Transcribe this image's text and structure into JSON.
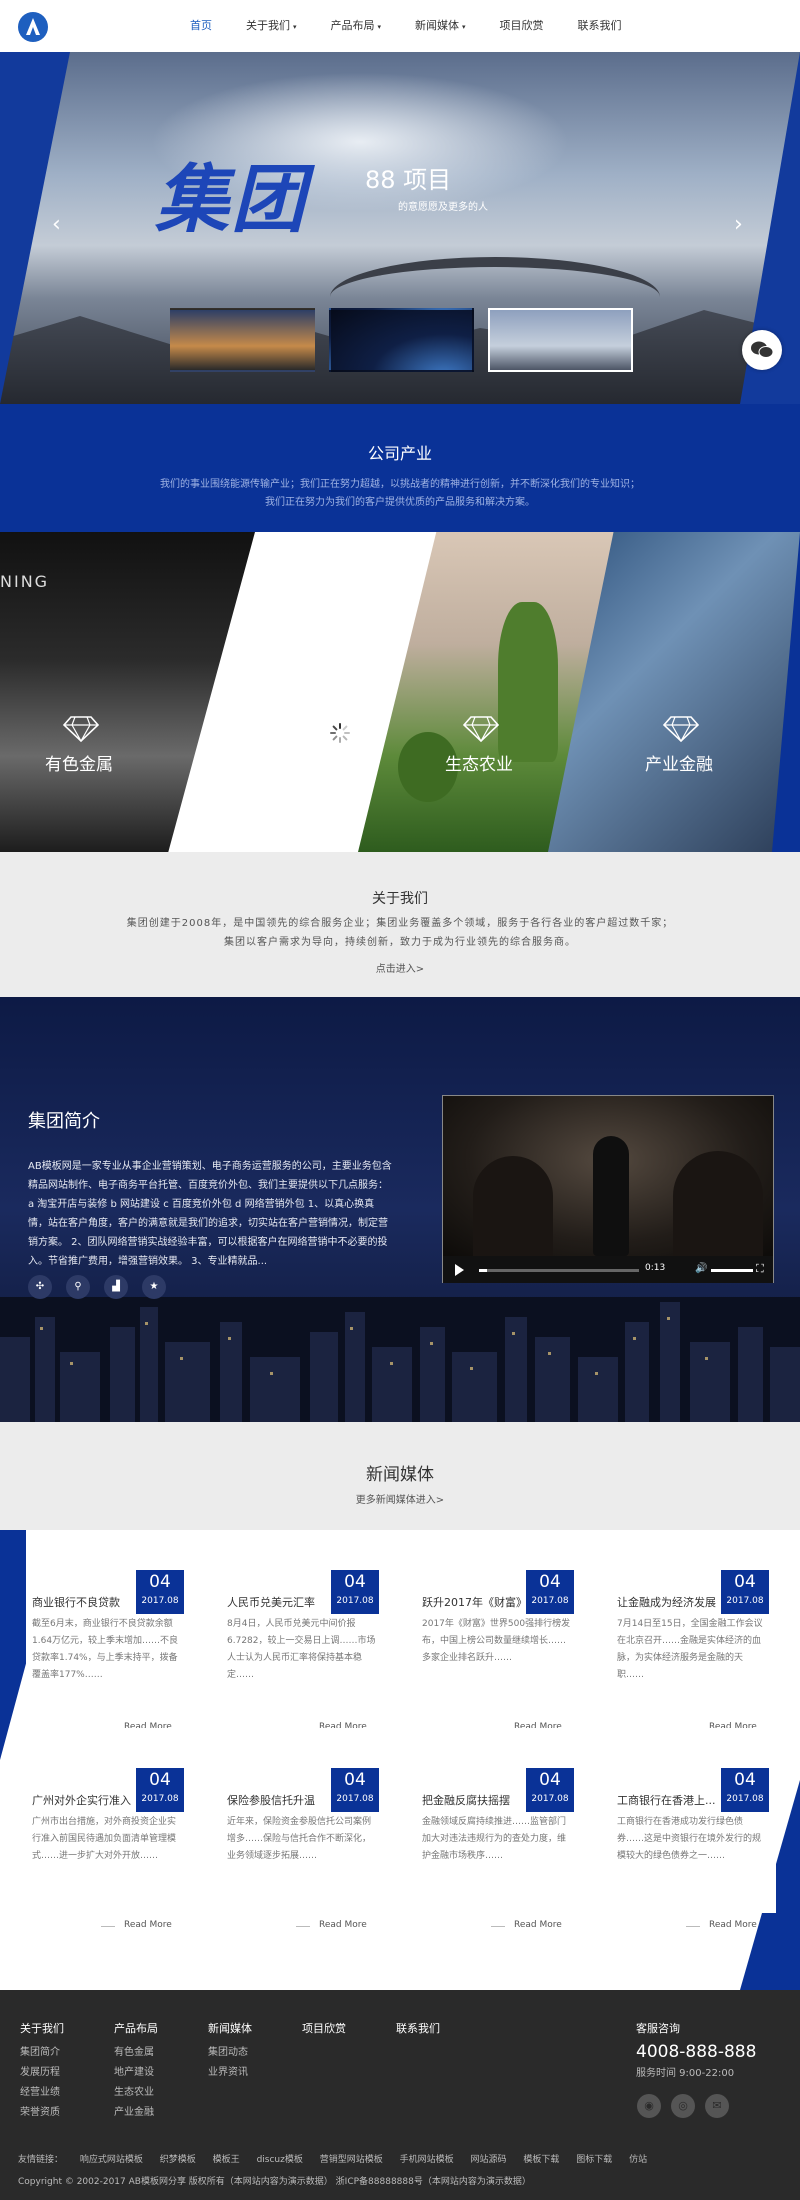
{
  "nav": {
    "items": [
      {
        "label": "首页",
        "active": true,
        "dropdown": false
      },
      {
        "label": "关于我们",
        "active": false,
        "dropdown": true
      },
      {
        "label": "产品布局",
        "active": false,
        "dropdown": true
      },
      {
        "label": "新闻媒体",
        "active": false,
        "dropdown": true
      },
      {
        "label": "项目欣赏",
        "active": false,
        "dropdown": false
      },
      {
        "label": "联系我们",
        "active": false,
        "dropdown": false
      }
    ],
    "caret": "▾"
  },
  "hero": {
    "title": "集团",
    "number_text": "88 项目",
    "subtitle": "的意愿愿及更多的人",
    "prev": "‹",
    "next": "›"
  },
  "industry": {
    "title": "公司产业",
    "desc_line1": "我们的事业围绕能源传输产业；我们正在努力超越，以挑战者的精神进行创新，并不断深化我们的专业知识；",
    "desc_line2": "我们正在努力为我们的客户提供优质的产品服务和解决方案。"
  },
  "triptych": {
    "panels": [
      {
        "label": "有色金属",
        "sign": "NING"
      },
      {
        "label": "生态农业"
      },
      {
        "label": "产业金融"
      }
    ]
  },
  "about": {
    "title": "关于我们",
    "line1": "集团创建于2008年，是中国领先的综合服务企业；集团业务覆盖多个领域，服务于各行各业的客户超过数千家；",
    "line2": "集团以客户需求为导向，持续创新，致力于成为行业领先的综合服务商。",
    "more": "点击进入>"
  },
  "group": {
    "title": "集团简介",
    "text": "AB模板网是一家专业从事企业营销策划、电子商务运营服务的公司，主要业务包含精品网站制作、电子商务平台托管、百度竞价外包、我们主要提供以下几点服务：a 淘宝开店与装修 b 网站建设 c 百度竞价外包 d 网络营销外包 1、以真心换真情，站在客户角度，客户的满意就是我们的追求，切实站在客户营销情况，制定营销方案。 2、团队网络营销实战经验丰富，可以根据客户在网络营销中不必要的投入。节省推广费用，增强营销效果。 3、专业精就品...",
    "video_time": "0:13"
  },
  "news_section": {
    "title": "新闻媒体",
    "more": "更多新闻媒体进入>"
  },
  "news": [
    {
      "day": "04",
      "ym": "2017.08",
      "title": "商业银行不良贷款",
      "summary": "截至6月末，商业银行不良贷款余额1.64万亿元，较上季末增加……不良贷款率1.74%，与上季末持平，拨备覆盖率177%……",
      "read_more": "Read More"
    },
    {
      "day": "04",
      "ym": "2017.08",
      "title": "人民币兑美元汇率",
      "summary": "8月4日，人民币兑美元中间价报6.7282，较上一交易日上调……市场人士认为人民币汇率将保持基本稳定……",
      "read_more": "Read More"
    },
    {
      "day": "04",
      "ym": "2017.08",
      "title": "跃升2017年《财富》",
      "summary": "2017年《财富》世界500强排行榜发布，中国上榜公司数量继续增长……多家企业排名跃升……",
      "read_more": "Read More"
    },
    {
      "day": "04",
      "ym": "2017.08",
      "title": "让金融成为经济发展",
      "summary": "7月14日至15日，全国金融工作会议在北京召开……金融是实体经济的血脉，为实体经济服务是金融的天职……",
      "read_more": "Read More"
    },
    {
      "day": "04",
      "ym": "2017.08",
      "title": "广州对外企实行准入",
      "summary": "广州市出台措施，对外商投资企业实行准入前国民待遇加负面清单管理模式……进一步扩大对外开放……",
      "read_more": "Read More"
    },
    {
      "day": "04",
      "ym": "2017.08",
      "title": "保险参股信托升温",
      "summary": "近年来，保险资金参股信托公司案例增多……保险与信托合作不断深化，业务领域逐步拓展……",
      "read_more": "Read More"
    },
    {
      "day": "04",
      "ym": "2017.08",
      "title": "把金融反腐扶摇摆",
      "summary": "金融领域反腐持续推进……监管部门加大对违法违规行为的查处力度，维护金融市场秩序……",
      "read_more": "Read More"
    },
    {
      "day": "04",
      "ym": "2017.08",
      "title": "工商银行在香港上...",
      "summary": "工商银行在香港成功发行绿色债券……这是中资银行在境外发行的规模较大的绿色债券之一……",
      "read_more": "Read More"
    }
  ],
  "footer": {
    "columns": [
      {
        "heading": "关于我们",
        "items": [
          "集团简介",
          "发展历程",
          "经营业绩",
          "荣誉资质"
        ]
      },
      {
        "heading": "产品布局",
        "items": [
          "有色金属",
          "地产建设",
          "生态农业",
          "产业金融"
        ]
      },
      {
        "heading": "新闻媒体",
        "items": [
          "集团动态",
          "业界资讯"
        ]
      },
      {
        "heading": "项目欣赏",
        "items": []
      },
      {
        "heading": "联系我们",
        "items": []
      }
    ],
    "contact": {
      "heading": "客服咨询",
      "phone": "4008-888-888",
      "hours": "服务时间 9:00-22:00"
    },
    "links_label": "友情链接：",
    "links": [
      "响应式网站模板",
      "织梦模板",
      "模板王",
      "discuz模板",
      "营销型网站模板",
      "手机网站模板",
      "网站源码",
      "模板下载",
      "图标下载",
      "仿站"
    ],
    "copyright": "Copyright © 2002-2017 AB模板网分享 版权所有（本网站内容为演示数据） 浙ICP备88888888号（本网站内容为演示数据）"
  },
  "colors": {
    "brand_blue": "#0a3297",
    "nav_active": "#1e5fbf",
    "footer_bg": "#2a2a2a"
  }
}
